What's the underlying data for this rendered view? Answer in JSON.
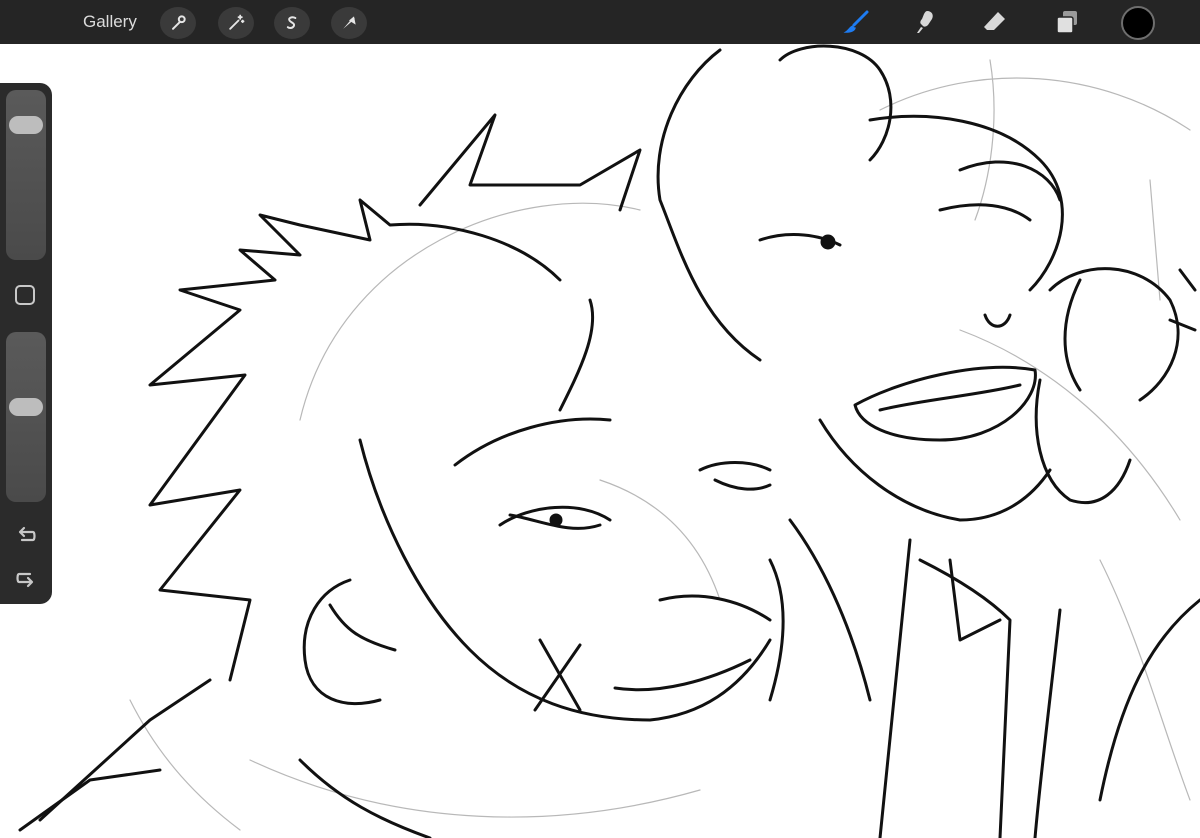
{
  "toolbar": {
    "gallery_label": "Gallery",
    "left_tools": [
      "wrench-icon",
      "magic-wand-icon",
      "selection-icon",
      "transform-arrow-icon"
    ],
    "right_tools": [
      "brush-icon",
      "smudge-icon",
      "eraser-icon",
      "layers-icon"
    ],
    "active_tool": "brush-icon",
    "active_color": "#1e7cf2",
    "current_color": "#000000"
  },
  "sidebar": {
    "brush_size_level": 0.85,
    "opacity_level": 0.57,
    "icons": [
      "modify-square-icon",
      "undo-icon",
      "redo-icon"
    ]
  }
}
